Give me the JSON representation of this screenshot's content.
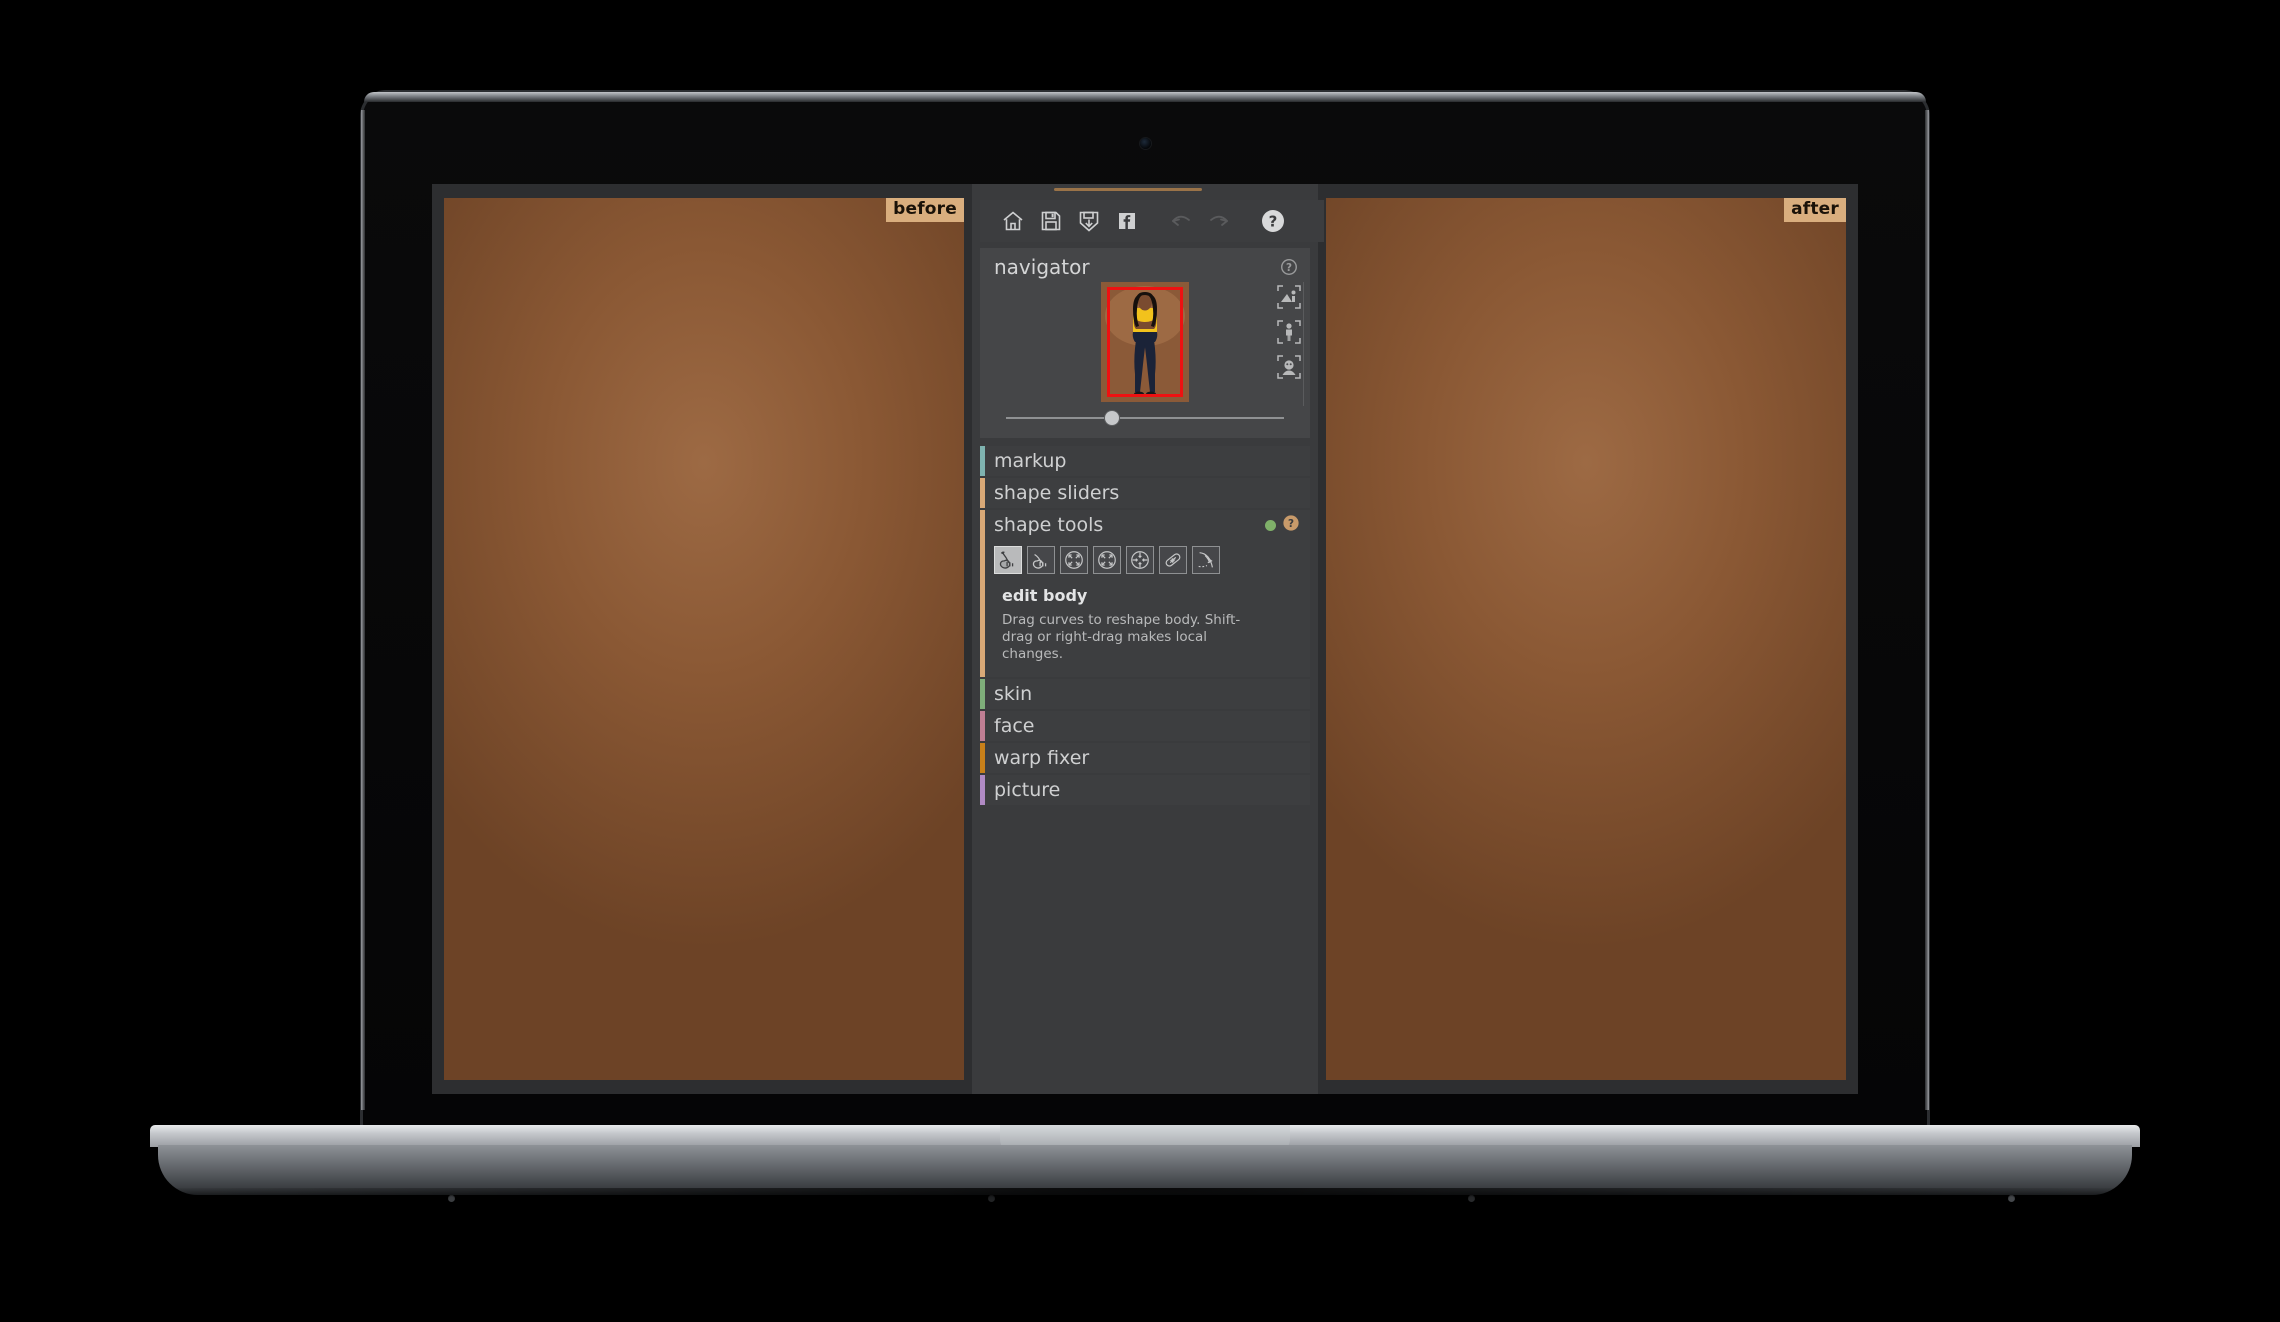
{
  "app": {
    "name": "portrait-retouching-app",
    "panel_bg": "#3a3b3d"
  },
  "viewer": {
    "before_label": "before",
    "after_label": "after"
  },
  "toolbar": {
    "items": [
      {
        "name": "home-icon",
        "label": "home",
        "enabled": true
      },
      {
        "name": "save-icon",
        "label": "save",
        "enabled": true
      },
      {
        "name": "save-as-icon",
        "label": "save as",
        "enabled": true
      },
      {
        "name": "facebook-icon",
        "label": "facebook",
        "enabled": true
      },
      {
        "name": "undo-icon",
        "label": "undo",
        "enabled": false
      },
      {
        "name": "redo-icon",
        "label": "redo",
        "enabled": false
      },
      {
        "name": "help-icon",
        "label": "help",
        "enabled": true
      }
    ]
  },
  "navigator": {
    "title": "navigator",
    "help_label": "?",
    "zoom_percent": 38,
    "viewport_color": "#ee1111",
    "frame_buttons": [
      {
        "name": "fit-whole-image-button",
        "label": "fit whole image"
      },
      {
        "name": "fit-body-button",
        "label": "fit body"
      },
      {
        "name": "fit-face-button",
        "label": "fit face"
      }
    ]
  },
  "panels": [
    {
      "id": "markup",
      "label": "markup",
      "accent": "#7fb3b0",
      "expanded": false
    },
    {
      "id": "shape-sliders",
      "label": "shape sliders",
      "accent": "#d9a977",
      "expanded": false
    },
    {
      "id": "shape-tools",
      "label": "shape tools",
      "accent": "#d9a977",
      "expanded": true,
      "status_dot": "#7fb069",
      "help_label": "?",
      "tools": [
        {
          "name": "edit-body-tool",
          "label": "edit body",
          "selected": true
        },
        {
          "name": "push-tool",
          "label": "push",
          "selected": false
        },
        {
          "name": "shrink-tool",
          "label": "shrink",
          "selected": false
        },
        {
          "name": "grow-tool",
          "label": "grow",
          "selected": false
        },
        {
          "name": "pinch-tool",
          "label": "pinch",
          "selected": false
        },
        {
          "name": "heal-tool",
          "label": "heal",
          "selected": false
        },
        {
          "name": "curve-tool",
          "label": "curve",
          "selected": false
        }
      ],
      "selected_tool_name": "edit body",
      "selected_tool_description": "Drag curves to reshape body.  Shift-drag or right-drag makes local changes."
    },
    {
      "id": "skin",
      "label": "skin",
      "accent": "#7fae7a",
      "expanded": false
    },
    {
      "id": "face",
      "label": "face",
      "accent": "#c07f94",
      "expanded": false
    },
    {
      "id": "warp-fixer",
      "label": "warp fixer",
      "accent": "#c8801a",
      "expanded": false
    },
    {
      "id": "picture",
      "label": "picture",
      "accent": "#b08ac4",
      "expanded": false
    }
  ],
  "photo": {
    "background_color": "#8b5a38",
    "top_color": "#a06e47",
    "subject": {
      "top_color": "#f2c21c",
      "jeans_color": "#1d2538",
      "skin_color": "#7a4b30",
      "hair_color": "#16100d",
      "shoe_color": "#1a1a1c",
      "lip_color": "#b83a5c",
      "glasses_color": "#2a2c34"
    }
  }
}
